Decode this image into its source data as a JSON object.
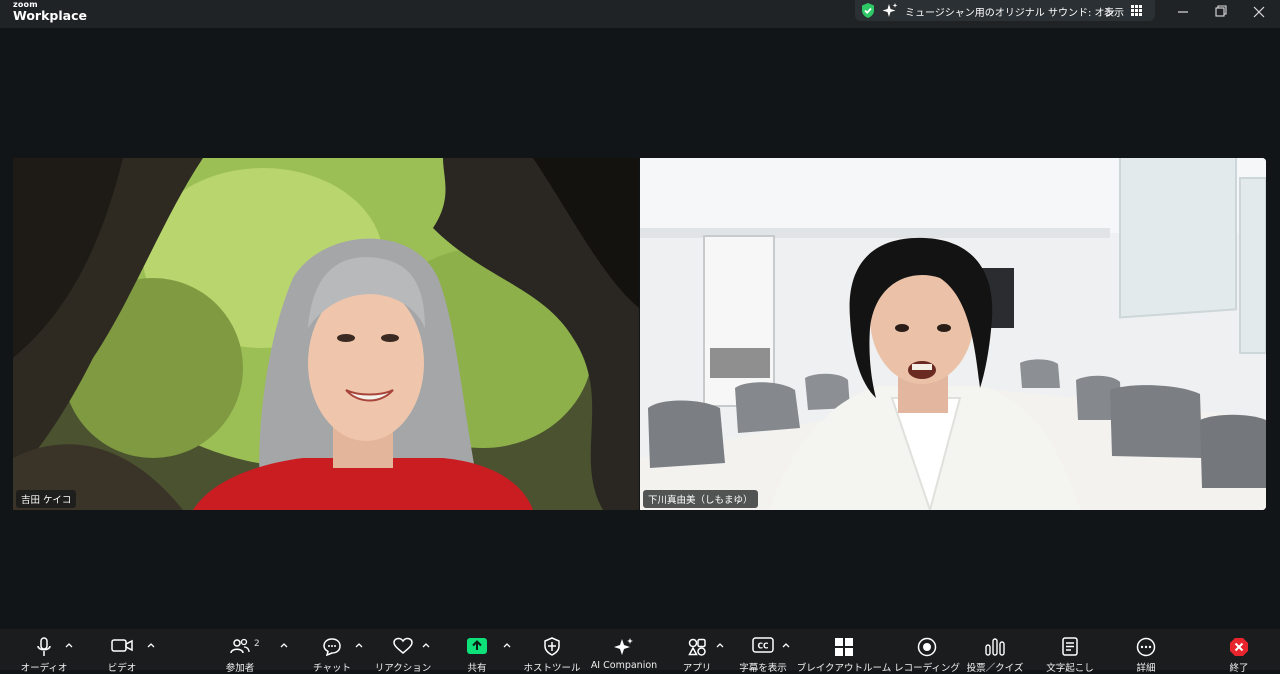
{
  "app": {
    "brand_small": "zoom",
    "brand": "Workplace"
  },
  "notification": {
    "message": "ミュージシャン用のオリジナル サウンド: オン",
    "view_label": "表示"
  },
  "participants": [
    {
      "name": "吉田 ケイコ"
    },
    {
      "name": "下川真由美（しもまゆ）"
    }
  ],
  "toolbar": {
    "audio": "オーディオ",
    "video": "ビデオ",
    "participants": "参加者",
    "participants_count": "2",
    "chat": "チャット",
    "reactions": "リアクション",
    "share": "共有",
    "host_tools": "ホストツール",
    "ai_companion": "AI Companion",
    "apps": "アプリ",
    "captions": "字幕を表示",
    "breakout": "ブレイクアウトルーム",
    "recording": "レコーディング",
    "polls": "投票／クイズ",
    "transcript": "文字起こし",
    "more": "詳細",
    "end": "終了"
  },
  "colors": {
    "share_green": "#0ee07a",
    "end_red": "#e8242c",
    "shield_green": "#2ec866"
  }
}
